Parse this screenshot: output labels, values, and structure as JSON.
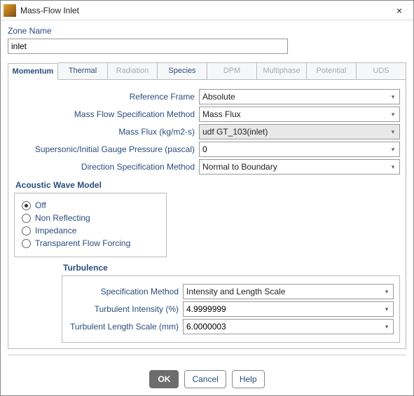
{
  "window": {
    "title": "Mass-Flow Inlet",
    "close_icon": "×"
  },
  "zone": {
    "label": "Zone Name",
    "value": "inlet"
  },
  "tabs": [
    {
      "label": "Momentum",
      "state": "active"
    },
    {
      "label": "Thermal",
      "state": "normal"
    },
    {
      "label": "Radiation",
      "state": "disabled"
    },
    {
      "label": "Species",
      "state": "normal"
    },
    {
      "label": "DPM",
      "state": "disabled"
    },
    {
      "label": "Multiphase",
      "state": "disabled"
    },
    {
      "label": "Potential",
      "state": "disabled"
    },
    {
      "label": "UDS",
      "state": "disabled"
    }
  ],
  "momentum": {
    "reference_frame": {
      "label": "Reference Frame",
      "value": "Absolute"
    },
    "spec_method": {
      "label": "Mass Flow Specification Method",
      "value": "Mass Flux"
    },
    "mass_flux": {
      "label": "Mass Flux (kg/m2-s)",
      "value": "udf GT_103(inlet)"
    },
    "gauge_pressure": {
      "label": "Supersonic/Initial Gauge Pressure (pascal)",
      "value": "0"
    },
    "direction_method": {
      "label": "Direction Specification Method",
      "value": "Normal to Boundary"
    }
  },
  "acoustic": {
    "title": "Acoustic Wave Model",
    "options": [
      {
        "label": "Off",
        "checked": true
      },
      {
        "label": "Non Reflecting",
        "checked": false
      },
      {
        "label": "Impedance",
        "checked": false
      },
      {
        "label": "Transparent Flow Forcing",
        "checked": false
      }
    ]
  },
  "turbulence": {
    "title": "Turbulence",
    "spec_method": {
      "label": "Specification Method",
      "value": "Intensity and Length Scale"
    },
    "intensity": {
      "label": "Turbulent Intensity (%)",
      "value": "4.9999999"
    },
    "length": {
      "label": "Turbulent Length Scale (mm)",
      "value": "6.0000003"
    }
  },
  "footer": {
    "ok": "OK",
    "cancel": "Cancel",
    "help": "Help"
  }
}
